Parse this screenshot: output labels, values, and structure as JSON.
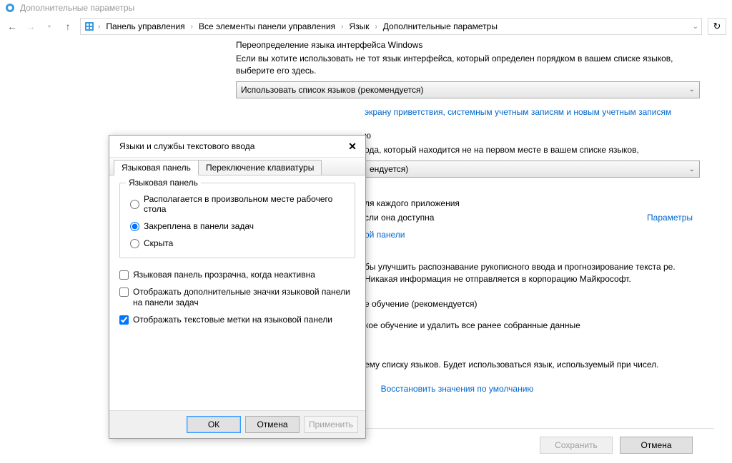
{
  "window": {
    "title": "Дополнительные параметры"
  },
  "breadcrumb": {
    "items": [
      "Панель управления",
      "Все элементы панели управления",
      "Язык",
      "Дополнительные параметры"
    ]
  },
  "page": {
    "sec1_heading": "Переопределение языка интерфейса Windows",
    "sec1_text": "Если вы хотите использовать не тот язык интерфейса, который определен порядком в вашем списке языков, выберите его здесь.",
    "sec1_dropdown": "Использовать список языков (рекомендуется)",
    "sec1_link": "экрану приветствия, системным учетным записям и новым учетным записям",
    "sec2_frag1": "ю",
    "sec2_text": "ода, который находится не на первом месте в вашем списке языков,",
    "sec2_dropdown": "ендуется)",
    "sec3_frag": "ля каждого приложения",
    "sec3_text": "сли она доступна",
    "sec3_param": "Параметры",
    "sec3_link": "ой панели",
    "sec4_text": "бы улучшить распознавание рукописного ввода и прогнозирование текста ре. Никакая информация не отправляется в корпорацию Майкрософт.",
    "sec4_line1": "е обучение (рекомендуется)",
    "sec4_line2": "кое обучение и удалить все ранее собранные данные",
    "sec5_text": "ему списку языков. Будет использоваться язык, используемый при чисел.",
    "restore": "Восстановить значения по умолчанию",
    "save": "Сохранить",
    "cancel": "Отмена"
  },
  "dialog": {
    "title": "Языки и службы текстового ввода",
    "tabs": [
      "Языковая панель",
      "Переключение клавиатуры"
    ],
    "groupbox_title": "Языковая панель",
    "radio1": "Располагается в произвольном месте рабочего стола",
    "radio2": "Закреплена в панели задач",
    "radio3": "Скрыта",
    "check1": "Языковая панель прозрачна, когда неактивна",
    "check2": "Отображать дополнительные значки языковой панели на панели задач",
    "check3": "Отображать текстовые метки на языковой панели",
    "ok": "ОК",
    "cancel": "Отмена",
    "apply": "Применить"
  }
}
